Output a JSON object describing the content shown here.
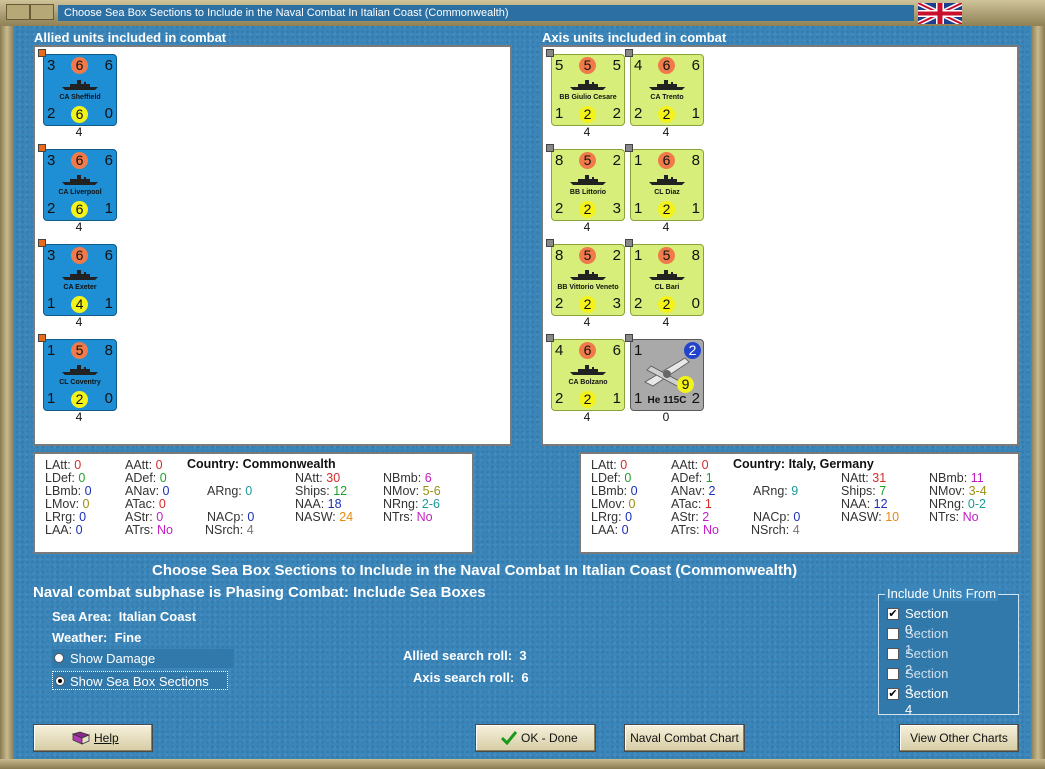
{
  "window": {
    "title": "Choose Sea Box Sections to Include in the Naval Combat In Italian Coast (Commonwealth)"
  },
  "allied": {
    "title": "Allied units included in combat",
    "units": [
      {
        "name": "CA Sheffield",
        "tl": "3",
        "tc": "6",
        "tr": "6",
        "bl": "2",
        "bc": "6",
        "br": "0",
        "count": "4"
      },
      {
        "name": "CA Liverpool",
        "tl": "3",
        "tc": "6",
        "tr": "6",
        "bl": "2",
        "bc": "6",
        "br": "1",
        "count": "4"
      },
      {
        "name": "CA Exeter",
        "tl": "3",
        "tc": "6",
        "tr": "6",
        "bl": "1",
        "bc": "4",
        "br": "1",
        "count": "4"
      },
      {
        "name": "CL Coventry",
        "tl": "1",
        "tc": "5",
        "tr": "8",
        "bl": "1",
        "bc": "2",
        "br": "0",
        "count": "4"
      }
    ],
    "stats": {
      "LAtt": "0",
      "LDef": "0",
      "LBmb": "0",
      "LMov": "0",
      "LRrg": "0",
      "LAA": "0",
      "AAtt": "0",
      "ADef": "0",
      "ANav": "0",
      "ATac": "0",
      "AStr": "0",
      "ATrs": "No",
      "country_label": "Country:",
      "country": "Commonwealth",
      "ARng": "0",
      "NACp": "0",
      "NSrch": "4",
      "NAtt": "30",
      "Ships": "12",
      "NAA": "18",
      "NASW": "24",
      "NBmb": "6",
      "NMov": "5-6",
      "NRng": "2-6",
      "NTrs": "No"
    }
  },
  "axis": {
    "title": "Axis units included in combat",
    "units": [
      {
        "name": "BB Giulio Cesare",
        "tl": "5",
        "tc": "5",
        "tr": "5",
        "bl": "1",
        "bc": "2",
        "br": "2",
        "count": "4"
      },
      {
        "name": "CA Trento",
        "tl": "4",
        "tc": "6",
        "tr": "6",
        "bl": "2",
        "bc": "2",
        "br": "1",
        "count": "4"
      },
      {
        "name": "BB Littorio",
        "tl": "8",
        "tc": "5",
        "tr": "2",
        "bl": "2",
        "bc": "2",
        "br": "3",
        "count": "4"
      },
      {
        "name": "CL Diaz",
        "tl": "1",
        "tc": "6",
        "tr": "8",
        "bl": "1",
        "bc": "2",
        "br": "1",
        "count": "4"
      },
      {
        "name": "BB Vittorio Veneto",
        "tl": "8",
        "tc": "5",
        "tr": "2",
        "bl": "2",
        "bc": "2",
        "br": "3",
        "count": "4"
      },
      {
        "name": "CL Bari",
        "tl": "1",
        "tc": "5",
        "tr": "8",
        "bl": "2",
        "bc": "2",
        "br": "0",
        "count": "4"
      },
      {
        "name": "CA Bolzano",
        "tl": "4",
        "tc": "6",
        "tr": "6",
        "bl": "2",
        "bc": "2",
        "br": "1",
        "count": "4"
      },
      {
        "name": "He 115C",
        "tl": "1",
        "tc": "",
        "tr": "2",
        "bl": "1",
        "bc": "9",
        "br": "2",
        "count": "0"
      }
    ],
    "stats": {
      "LAtt": "0",
      "LDef": "0",
      "LBmb": "0",
      "LMov": "0",
      "LRrg": "0",
      "LAA": "0",
      "AAtt": "0",
      "ADef": "1",
      "ANav": "2",
      "ATac": "1",
      "AStr": "2",
      "ATrs": "No",
      "country_label": "Country:",
      "country": "Italy, Germany",
      "ARng": "9",
      "NACp": "0",
      "NSrch": "4",
      "NAtt": "31",
      "Ships": "7",
      "NAA": "12",
      "NASW": "10",
      "NBmb": "11",
      "NMov": "3-4",
      "NRng": "0-2",
      "NTrs": "No"
    }
  },
  "heading": "Choose Sea Box Sections to Include in the Naval Combat In Italian Coast (Commonwealth)",
  "subheading": "Naval combat subphase is Phasing Combat: Include Sea Boxes",
  "sea_area_label": "Sea Area:",
  "sea_area": "Italian Coast",
  "weather_label": "Weather:",
  "weather": "Fine",
  "options": {
    "show_damage": "Show Damage",
    "show_sea_box": "Show Sea Box Sections",
    "selected": "show_sea_box"
  },
  "search": {
    "allied_label": "Allied search roll:",
    "allied": "3",
    "axis_label": "Axis search roll:",
    "axis": "6"
  },
  "include_units": {
    "title": "Include Units From",
    "sections": [
      {
        "label": "Section 0",
        "checked": true
      },
      {
        "label": "Section 1",
        "checked": false
      },
      {
        "label": "Section 2",
        "checked": false
      },
      {
        "label": "Section 3",
        "checked": false
      },
      {
        "label": "Section 4",
        "checked": true
      }
    ]
  },
  "buttons": {
    "help": "Help",
    "ok": "OK - Done",
    "naval_chart": "Naval Combat Chart",
    "other_charts": "View Other Charts"
  },
  "colors": {
    "allied_counter": "#1e8fd4",
    "axis_counter": "#d8ee7a",
    "air_counter": "#a9a9a9",
    "background": "#3a86bb"
  }
}
